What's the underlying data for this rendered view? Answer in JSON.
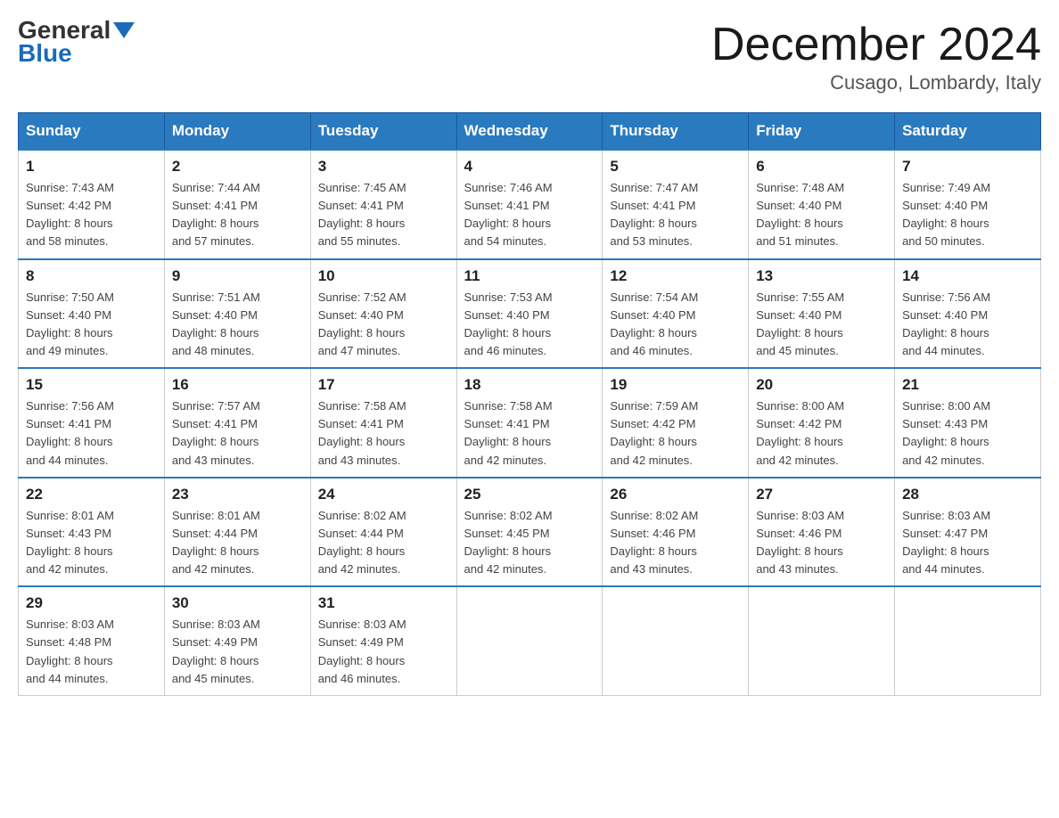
{
  "header": {
    "logo_general": "General",
    "logo_blue": "Blue",
    "month_title": "December 2024",
    "location": "Cusago, Lombardy, Italy"
  },
  "days_of_week": [
    "Sunday",
    "Monday",
    "Tuesday",
    "Wednesday",
    "Thursday",
    "Friday",
    "Saturday"
  ],
  "weeks": [
    [
      {
        "day": "1",
        "sunrise": "7:43 AM",
        "sunset": "4:42 PM",
        "daylight": "8 hours and 58 minutes."
      },
      {
        "day": "2",
        "sunrise": "7:44 AM",
        "sunset": "4:41 PM",
        "daylight": "8 hours and 57 minutes."
      },
      {
        "day": "3",
        "sunrise": "7:45 AM",
        "sunset": "4:41 PM",
        "daylight": "8 hours and 55 minutes."
      },
      {
        "day": "4",
        "sunrise": "7:46 AM",
        "sunset": "4:41 PM",
        "daylight": "8 hours and 54 minutes."
      },
      {
        "day": "5",
        "sunrise": "7:47 AM",
        "sunset": "4:41 PM",
        "daylight": "8 hours and 53 minutes."
      },
      {
        "day": "6",
        "sunrise": "7:48 AM",
        "sunset": "4:40 PM",
        "daylight": "8 hours and 51 minutes."
      },
      {
        "day": "7",
        "sunrise": "7:49 AM",
        "sunset": "4:40 PM",
        "daylight": "8 hours and 50 minutes."
      }
    ],
    [
      {
        "day": "8",
        "sunrise": "7:50 AM",
        "sunset": "4:40 PM",
        "daylight": "8 hours and 49 minutes."
      },
      {
        "day": "9",
        "sunrise": "7:51 AM",
        "sunset": "4:40 PM",
        "daylight": "8 hours and 48 minutes."
      },
      {
        "day": "10",
        "sunrise": "7:52 AM",
        "sunset": "4:40 PM",
        "daylight": "8 hours and 47 minutes."
      },
      {
        "day": "11",
        "sunrise": "7:53 AM",
        "sunset": "4:40 PM",
        "daylight": "8 hours and 46 minutes."
      },
      {
        "day": "12",
        "sunrise": "7:54 AM",
        "sunset": "4:40 PM",
        "daylight": "8 hours and 46 minutes."
      },
      {
        "day": "13",
        "sunrise": "7:55 AM",
        "sunset": "4:40 PM",
        "daylight": "8 hours and 45 minutes."
      },
      {
        "day": "14",
        "sunrise": "7:56 AM",
        "sunset": "4:40 PM",
        "daylight": "8 hours and 44 minutes."
      }
    ],
    [
      {
        "day": "15",
        "sunrise": "7:56 AM",
        "sunset": "4:41 PM",
        "daylight": "8 hours and 44 minutes."
      },
      {
        "day": "16",
        "sunrise": "7:57 AM",
        "sunset": "4:41 PM",
        "daylight": "8 hours and 43 minutes."
      },
      {
        "day": "17",
        "sunrise": "7:58 AM",
        "sunset": "4:41 PM",
        "daylight": "8 hours and 43 minutes."
      },
      {
        "day": "18",
        "sunrise": "7:58 AM",
        "sunset": "4:41 PM",
        "daylight": "8 hours and 42 minutes."
      },
      {
        "day": "19",
        "sunrise": "7:59 AM",
        "sunset": "4:42 PM",
        "daylight": "8 hours and 42 minutes."
      },
      {
        "day": "20",
        "sunrise": "8:00 AM",
        "sunset": "4:42 PM",
        "daylight": "8 hours and 42 minutes."
      },
      {
        "day": "21",
        "sunrise": "8:00 AM",
        "sunset": "4:43 PM",
        "daylight": "8 hours and 42 minutes."
      }
    ],
    [
      {
        "day": "22",
        "sunrise": "8:01 AM",
        "sunset": "4:43 PM",
        "daylight": "8 hours and 42 minutes."
      },
      {
        "day": "23",
        "sunrise": "8:01 AM",
        "sunset": "4:44 PM",
        "daylight": "8 hours and 42 minutes."
      },
      {
        "day": "24",
        "sunrise": "8:02 AM",
        "sunset": "4:44 PM",
        "daylight": "8 hours and 42 minutes."
      },
      {
        "day": "25",
        "sunrise": "8:02 AM",
        "sunset": "4:45 PM",
        "daylight": "8 hours and 42 minutes."
      },
      {
        "day": "26",
        "sunrise": "8:02 AM",
        "sunset": "4:46 PM",
        "daylight": "8 hours and 43 minutes."
      },
      {
        "day": "27",
        "sunrise": "8:03 AM",
        "sunset": "4:46 PM",
        "daylight": "8 hours and 43 minutes."
      },
      {
        "day": "28",
        "sunrise": "8:03 AM",
        "sunset": "4:47 PM",
        "daylight": "8 hours and 44 minutes."
      }
    ],
    [
      {
        "day": "29",
        "sunrise": "8:03 AM",
        "sunset": "4:48 PM",
        "daylight": "8 hours and 44 minutes."
      },
      {
        "day": "30",
        "sunrise": "8:03 AM",
        "sunset": "4:49 PM",
        "daylight": "8 hours and 45 minutes."
      },
      {
        "day": "31",
        "sunrise": "8:03 AM",
        "sunset": "4:49 PM",
        "daylight": "8 hours and 46 minutes."
      },
      null,
      null,
      null,
      null
    ]
  ],
  "labels": {
    "sunrise": "Sunrise:",
    "sunset": "Sunset:",
    "daylight": "Daylight:"
  }
}
